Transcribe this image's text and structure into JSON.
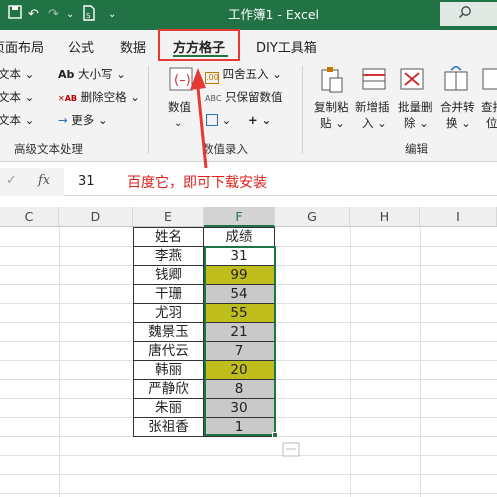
{
  "app": {
    "title": "工作簿1 - Excel"
  },
  "tabs": [
    {
      "label": "页面布局"
    },
    {
      "label": "公式"
    },
    {
      "label": "数据"
    },
    {
      "label": "方方格子"
    },
    {
      "label": "DIY工具箱"
    }
  ],
  "ribbon": {
    "text_group": {
      "items": [
        "文本",
        "文本",
        "文本"
      ],
      "case_label": "大小写",
      "del_space_label": "删除空格",
      "more_label": "更多",
      "group_label": "高级文本处理"
    },
    "number_group": {
      "value_label": "数值",
      "round_label": "四舍五入",
      "keep_value_label": "只保留数值",
      "group_label": "数值录入"
    },
    "edit_group": {
      "buttons": [
        {
          "line1": "复制粘",
          "line2": "贴"
        },
        {
          "line1": "新增插",
          "line2": "入"
        },
        {
          "line1": "批量删",
          "line2": "除"
        },
        {
          "line1": "合并转",
          "line2": "换"
        },
        {
          "line1": "查找",
          "line2": "位"
        }
      ],
      "group_label": "编辑"
    }
  },
  "formula_bar": {
    "value": "31",
    "fx": "fx",
    "annotation": "百度它，即可下载安装"
  },
  "columns": [
    "C",
    "D",
    "E",
    "F",
    "G",
    "H",
    "I"
  ],
  "table": {
    "headers": [
      "姓名",
      "成绩"
    ],
    "rows": [
      {
        "name": "李燕",
        "score": "31",
        "fill": "none"
      },
      {
        "name": "钱卿",
        "score": "99",
        "fill": "highlight"
      },
      {
        "name": "干珊",
        "score": "54",
        "fill": "gray"
      },
      {
        "name": "尤羽",
        "score": "55",
        "fill": "highlight"
      },
      {
        "name": "魏景玉",
        "score": "21",
        "fill": "gray"
      },
      {
        "name": "唐代云",
        "score": "7",
        "fill": "gray"
      },
      {
        "name": "韩丽",
        "score": "20",
        "fill": "highlight"
      },
      {
        "name": "严静欣",
        "score": "8",
        "fill": "gray"
      },
      {
        "name": "朱丽",
        "score": "30",
        "fill": "gray"
      },
      {
        "name": "张祖香",
        "score": "1",
        "fill": "gray"
      }
    ]
  },
  "colors": {
    "excel_green": "#217346",
    "highlight": "#bfbe1c",
    "gray_fill": "#c9c9c9",
    "annotation_red": "#e0201a"
  }
}
